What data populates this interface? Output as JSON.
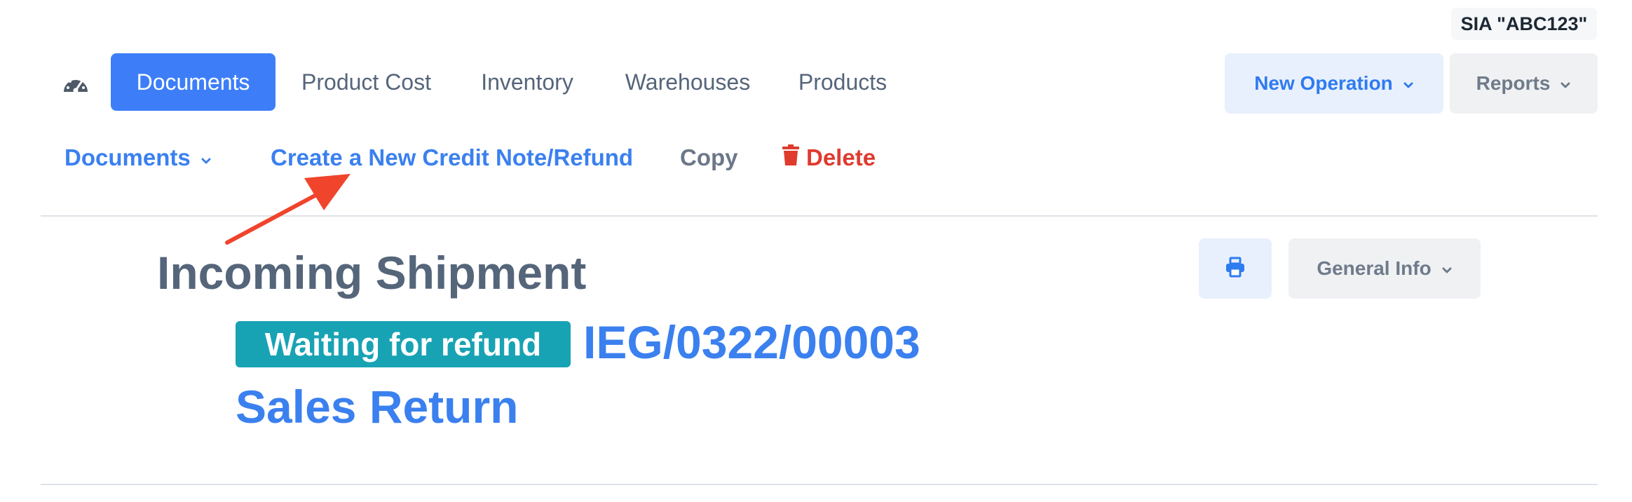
{
  "company": {
    "name": "SIA \"ABC123\""
  },
  "nav": {
    "dashboard_icon": "speedometer-icon",
    "tabs": [
      {
        "label": "Documents",
        "active": true
      },
      {
        "label": "Product Cost"
      },
      {
        "label": "Inventory"
      },
      {
        "label": "Warehouses"
      },
      {
        "label": "Products"
      }
    ],
    "new_operation": "New Operation",
    "reports": "Reports"
  },
  "subnav": {
    "documents": "Documents",
    "create_credit_note": "Create a New Credit Note/Refund",
    "copy": "Copy",
    "delete": "Delete",
    "delete_icon": "trash-icon"
  },
  "document": {
    "title": "Incoming Shipment",
    "status": "Waiting for refund",
    "number": "IEG/0322/00003",
    "type": "Sales Return",
    "print_icon": "printer-icon",
    "general_info": "General Info"
  },
  "colors": {
    "accent": "#3d7ef8",
    "status": "#18a3b4",
    "danger": "#df3b2f",
    "annotation_arrow": "#f0442c"
  }
}
